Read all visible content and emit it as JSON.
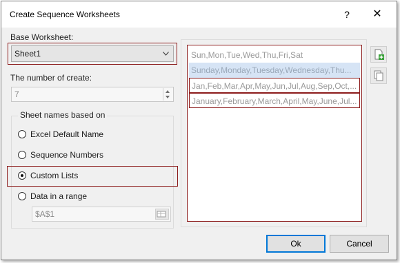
{
  "window": {
    "title": "Create Sequence Worksheets",
    "help_label": "?",
    "close_label": "✕"
  },
  "base_worksheet": {
    "label": "Base Worksheet:",
    "value": "Sheet1"
  },
  "number_of_create": {
    "label": "The number of create:",
    "value": "7"
  },
  "sheet_names": {
    "group_label": "Sheet names based on",
    "options": [
      {
        "label": "Excel Default Name",
        "selected": false
      },
      {
        "label": "Sequence Numbers",
        "selected": false
      },
      {
        "label": "Custom Lists",
        "selected": true
      },
      {
        "label": "Data in a range",
        "selected": false
      }
    ],
    "range_value": "$A$1"
  },
  "custom_lists": {
    "items": [
      "Sun,Mon,Tue,Wed,Thu,Fri,Sat",
      "Sunday,Monday,Tuesday,Wednesday,Thu...",
      "Jan,Feb,Mar,Apr,May,Jun,Jul,Aug,Sep,Oct,...",
      "January,February,March,April,May,June,Jul..."
    ],
    "selected_index": 1
  },
  "icons": {
    "add": "add-list-icon",
    "copy": "copy-list-icon",
    "range_select": "range-select-icon"
  },
  "buttons": {
    "ok": "Ok",
    "cancel": "Cancel"
  },
  "colors": {
    "highlight_border": "#8b1a1a",
    "selection": "#d6e4f5",
    "primary_border": "#0078d7"
  }
}
